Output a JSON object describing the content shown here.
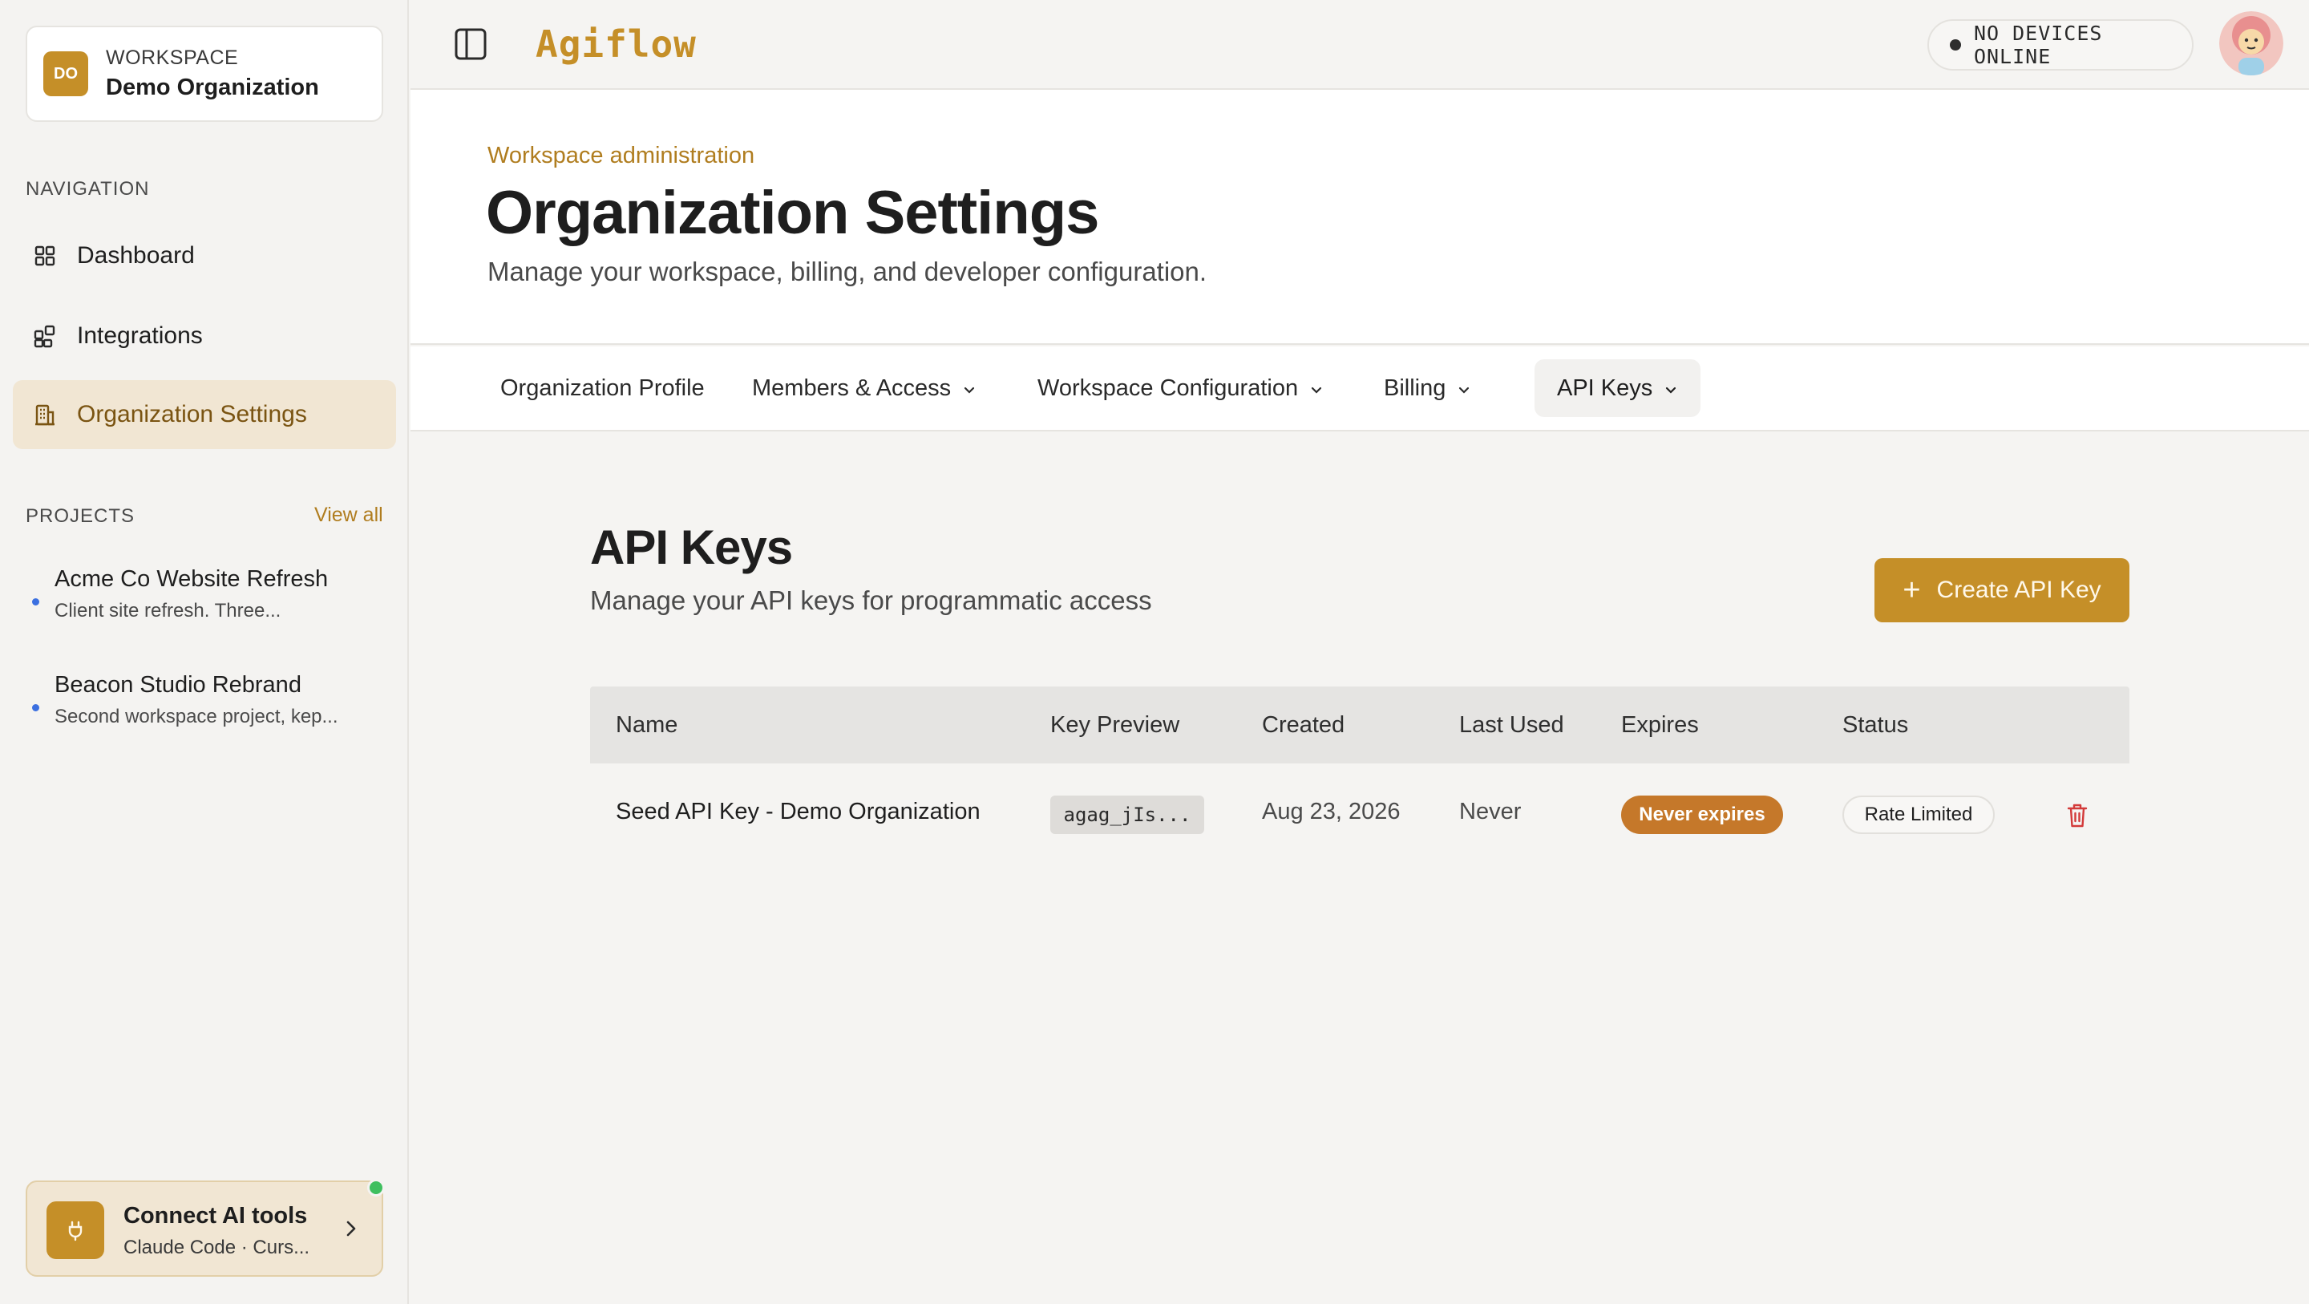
{
  "workspace": {
    "initials": "DO",
    "label": "WORKSPACE",
    "name": "Demo Organization"
  },
  "navigation": {
    "section_label": "NAVIGATION",
    "items": [
      {
        "label": "Dashboard",
        "icon": "grid-icon",
        "active": false
      },
      {
        "label": "Integrations",
        "icon": "puzzle-icon",
        "active": false
      },
      {
        "label": "Organization Settings",
        "icon": "building-icon",
        "active": true
      }
    ]
  },
  "projects": {
    "section_label": "PROJECTS",
    "view_all": "View all",
    "items": [
      {
        "name": "Acme Co Website Refresh",
        "description": "Client site refresh. Three..."
      },
      {
        "name": "Beacon Studio Rebrand",
        "description": "Second workspace project, kep..."
      }
    ]
  },
  "connect": {
    "title": "Connect AI tools",
    "subtitle": "Claude Code · Curs...",
    "status_color": "#3fbf5f"
  },
  "topbar": {
    "brand": "Agiflow",
    "devices_status": "NO DEVICES ONLINE"
  },
  "header": {
    "eyebrow": "Workspace administration",
    "title": "Organization Settings",
    "subtitle": "Manage your workspace, billing, and developer configuration."
  },
  "tabs": [
    {
      "label": "Organization Profile",
      "has_dropdown": false,
      "active": false
    },
    {
      "label": "Members & Access",
      "has_dropdown": true,
      "active": false
    },
    {
      "label": "Workspace Configuration",
      "has_dropdown": true,
      "active": false
    },
    {
      "label": "Billing",
      "has_dropdown": true,
      "active": false
    },
    {
      "label": "API Keys",
      "has_dropdown": true,
      "active": true
    }
  ],
  "api_keys": {
    "title": "API Keys",
    "subtitle": "Manage your API keys for programmatic access",
    "create_button": "Create API Key",
    "columns": [
      "Name",
      "Key Preview",
      "Created",
      "Last Used",
      "Expires",
      "Status"
    ],
    "rows": [
      {
        "name": "Seed API Key - Demo Organization",
        "key_preview": "agag_jIs...",
        "created": "Aug 23, 2026",
        "last_used": "Never",
        "expires": "Never expires",
        "status": "Rate Limited"
      }
    ]
  },
  "colors": {
    "accent": "#c58f28",
    "active_nav_bg": "#f1e6d3",
    "expires_badge": "#c5782a",
    "delete": "#d33a3a"
  }
}
